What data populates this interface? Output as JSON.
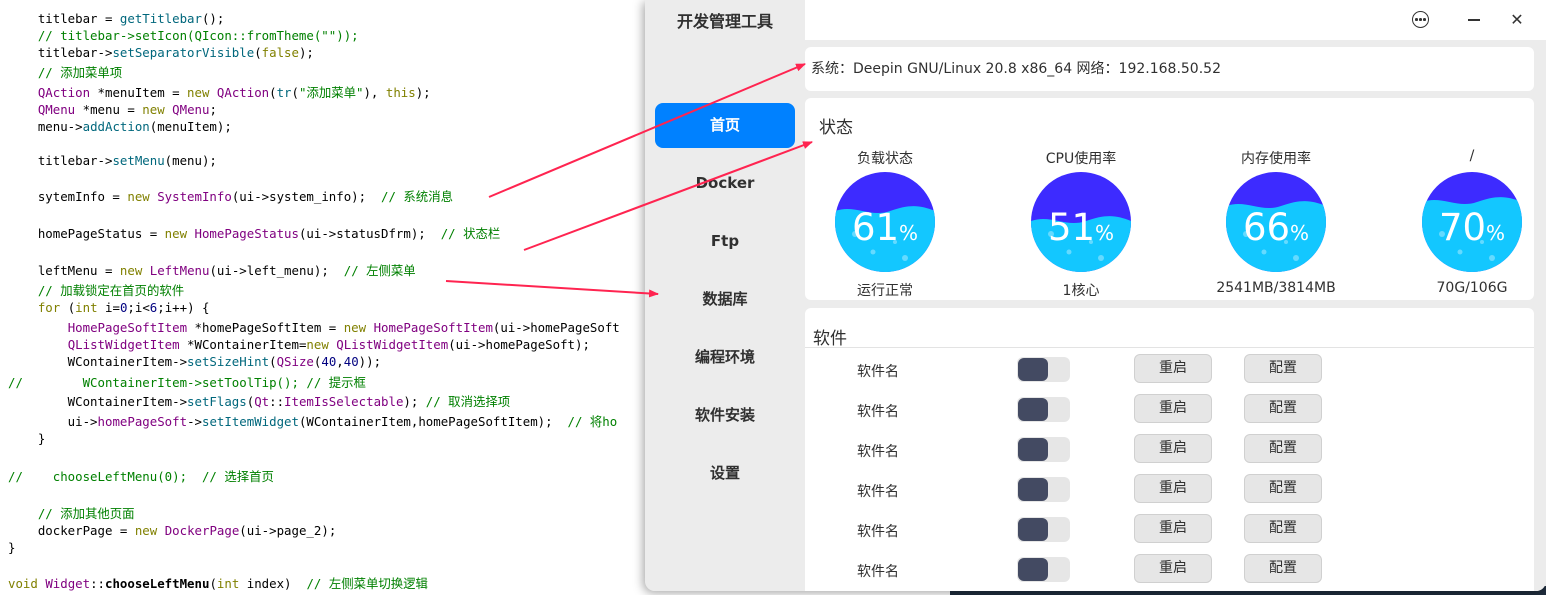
{
  "code": {
    "lines": [
      [
        [
          "    titlebar = "
        ],
        [
          "getTitlebar",
          "fn"
        ],
        [
          "();"
        ]
      ],
      [
        [
          "    // titlebar->setIcon(QIcon::fromTheme(\"\"));",
          "cm"
        ]
      ],
      [
        [
          "    titlebar->"
        ],
        [
          "setSeparatorVisible",
          "fn"
        ],
        [
          "("
        ],
        [
          "false",
          "kw"
        ],
        [
          ");"
        ]
      ],
      [
        [
          "    // 添加菜单项",
          "cm"
        ]
      ],
      [
        [
          "    "
        ],
        [
          "QAction",
          "ty"
        ],
        [
          " *menuItem = "
        ],
        [
          "new",
          "kw"
        ],
        [
          " "
        ],
        [
          "QAction",
          "ty"
        ],
        [
          "("
        ],
        [
          "tr",
          "fn"
        ],
        [
          "("
        ],
        [
          "\"添加菜单\"",
          "str"
        ],
        [
          "), "
        ],
        [
          "this",
          "kw"
        ],
        [
          ");"
        ]
      ],
      [
        [
          "    "
        ],
        [
          "QMenu",
          "ty"
        ],
        [
          " *menu = "
        ],
        [
          "new",
          "kw"
        ],
        [
          " "
        ],
        [
          "QMenu",
          "ty"
        ],
        [
          ";"
        ]
      ],
      [
        [
          "    menu->"
        ],
        [
          "addAction",
          "fn"
        ],
        [
          "(menuItem);"
        ]
      ],
      [
        [
          ""
        ]
      ],
      [
        [
          "    titlebar->"
        ],
        [
          "setMenu",
          "fn"
        ],
        [
          "(menu);"
        ]
      ],
      [
        [
          ""
        ]
      ],
      [
        [
          "    sytemInfo = "
        ],
        [
          "new",
          "kw"
        ],
        [
          " "
        ],
        [
          "SystemInfo",
          "ty"
        ],
        [
          "(ui->system_info);  "
        ],
        [
          "// 系统消息",
          "cm"
        ]
      ],
      [
        [
          ""
        ]
      ],
      [
        [
          "    homePageStatus = "
        ],
        [
          "new",
          "kw"
        ],
        [
          " "
        ],
        [
          "HomePageStatus",
          "ty"
        ],
        [
          "(ui->statusDfrm);  "
        ],
        [
          "// 状态栏",
          "cm"
        ]
      ],
      [
        [
          ""
        ]
      ],
      [
        [
          "    leftMenu = "
        ],
        [
          "new",
          "kw"
        ],
        [
          " "
        ],
        [
          "LeftMenu",
          "ty"
        ],
        [
          "(ui->left_menu);  "
        ],
        [
          "// 左侧菜单",
          "cm"
        ]
      ],
      [
        [
          "    // 加载锁定在首页的软件",
          "cm"
        ]
      ],
      [
        [
          "    "
        ],
        [
          "for",
          "kw"
        ],
        [
          " ("
        ],
        [
          "int",
          "kw"
        ],
        [
          " i="
        ],
        [
          "0",
          "num"
        ],
        [
          ";i<"
        ],
        [
          "6",
          "num"
        ],
        [
          ";i++) {"
        ]
      ],
      [
        [
          "        "
        ],
        [
          "HomePageSoftItem",
          "ty"
        ],
        [
          " *homePageSoftItem = "
        ],
        [
          "new",
          "kw"
        ],
        [
          " "
        ],
        [
          "HomePageSoftItem",
          "ty"
        ],
        [
          "(ui->homePageSoft"
        ]
      ],
      [
        [
          "        "
        ],
        [
          "QListWidgetItem",
          "ty"
        ],
        [
          " *WContainerItem="
        ],
        [
          "new",
          "kw"
        ],
        [
          " "
        ],
        [
          "QListWidgetItem",
          "ty"
        ],
        [
          "(ui->homePageSoft);"
        ]
      ],
      [
        [
          "        WContainerItem->"
        ],
        [
          "setSizeHint",
          "fn"
        ],
        [
          "("
        ],
        [
          "QSize",
          "ty"
        ],
        [
          "("
        ],
        [
          "40",
          "num"
        ],
        [
          ","
        ],
        [
          "40",
          "num"
        ],
        [
          "));"
        ]
      ],
      [
        [
          "//        WContainerItem->setToolTip(); // 提示框",
          "cm"
        ]
      ],
      [
        [
          "        WContainerItem->"
        ],
        [
          "setFlags",
          "fn"
        ],
        [
          "("
        ],
        [
          "Qt",
          "ty"
        ],
        [
          "::"
        ],
        [
          "ItemIsSelectable",
          "ty"
        ],
        [
          "); "
        ],
        [
          "// 取消选择项",
          "cm"
        ]
      ],
      [
        [
          "        ui->"
        ],
        [
          "homePageSoft",
          "ty"
        ],
        [
          "->"
        ],
        [
          "setItemWidget",
          "fn"
        ],
        [
          "(WContainerItem,homePageSoftItem);  "
        ],
        [
          "// 将ho",
          "cm"
        ]
      ],
      [
        [
          "    }"
        ]
      ],
      [
        [
          ""
        ]
      ],
      [
        [
          "//    chooseLeftMenu(0);  // 选择首页",
          "cm"
        ]
      ],
      [
        [
          ""
        ]
      ],
      [
        [
          "    // 添加其他页面",
          "cm"
        ]
      ],
      [
        [
          "    dockerPage = "
        ],
        [
          "new",
          "kw"
        ],
        [
          " "
        ],
        [
          "DockerPage",
          "ty"
        ],
        [
          "(ui->page_2);"
        ]
      ],
      [
        [
          "}"
        ]
      ],
      [
        [
          ""
        ]
      ],
      [
        [
          "void",
          "kw"
        ],
        [
          " "
        ],
        [
          "Widget",
          "ty"
        ],
        [
          "::"
        ],
        [
          "chooseLeftMenu",
          "bold"
        ],
        [
          "("
        ],
        [
          "int",
          "kw"
        ],
        [
          " index)  "
        ],
        [
          "// 左侧菜单切换逻辑",
          "cm"
        ]
      ]
    ]
  },
  "app": {
    "title": "开发管理工具",
    "menu": [
      {
        "label": "首页",
        "active": true
      },
      {
        "label": "Docker",
        "active": false
      },
      {
        "label": "Ftp",
        "active": false
      },
      {
        "label": "数据库",
        "active": false
      },
      {
        "label": "编程环境",
        "active": false
      },
      {
        "label": "软件安装",
        "active": false
      },
      {
        "label": "设置",
        "active": false
      }
    ],
    "titlebar": {
      "more_icon": "more-options-icon",
      "minimize_icon": "minimize-icon",
      "close_icon": "close-icon",
      "close_glyph": "✕"
    },
    "sysinfo": "系统：Deepin GNU/Linux 20.8  x86_64  网络：192.168.50.52",
    "status": {
      "title": "状态",
      "gauges": [
        {
          "label": "负载状态",
          "value": "61",
          "unit": "%",
          "fraction": 0.61,
          "sub": "运行正常"
        },
        {
          "label": "CPU使用率",
          "value": "51",
          "unit": "%",
          "fraction": 0.51,
          "sub": "1核心"
        },
        {
          "label": "内存使用率",
          "value": "66",
          "unit": "%",
          "fraction": 0.66,
          "sub": "2541MB/3814MB"
        },
        {
          "label": "/",
          "value": "70",
          "unit": "%",
          "fraction": 0.7,
          "sub": "70G/106G"
        }
      ]
    },
    "software": {
      "title": "软件",
      "rows": [
        {
          "name": "软件名",
          "restart": "重启",
          "config": "配置"
        },
        {
          "name": "软件名",
          "restart": "重启",
          "config": "配置"
        },
        {
          "name": "软件名",
          "restart": "重启",
          "config": "配置"
        },
        {
          "name": "软件名",
          "restart": "重启",
          "config": "配置"
        },
        {
          "name": "软件名",
          "restart": "重启",
          "config": "配置"
        },
        {
          "name": "软件名",
          "restart": "重启",
          "config": "配置"
        }
      ]
    }
  },
  "colors": {
    "accent": "#0081ff",
    "annotation_arrow": "#ff2450",
    "gauge_top": "#3d2bff",
    "gauge_fill": "#13c7ff",
    "toggle_knob": "#434a62"
  }
}
